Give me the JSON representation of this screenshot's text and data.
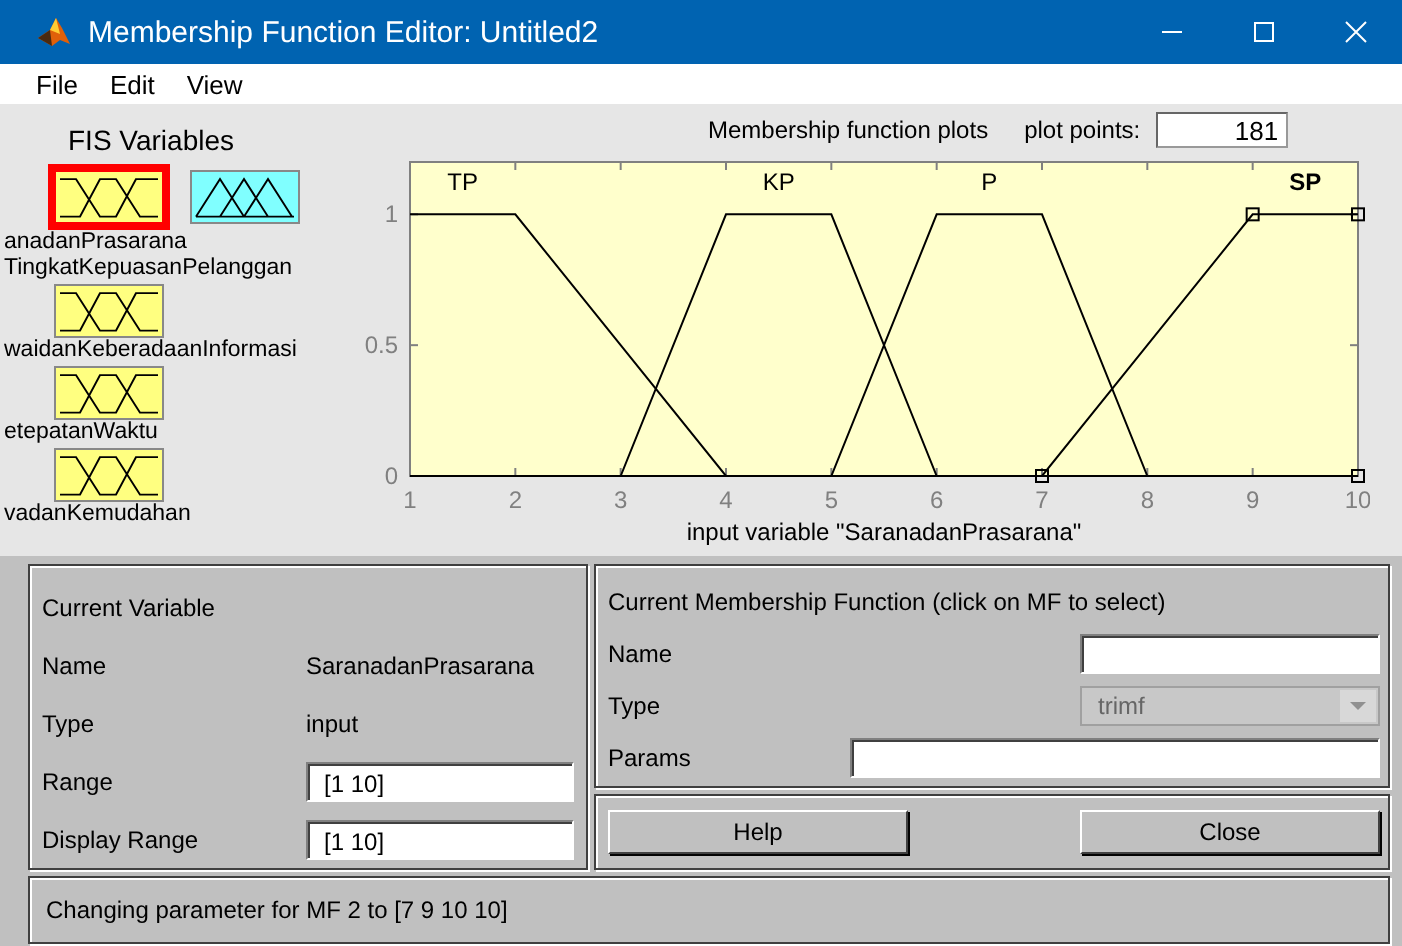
{
  "window": {
    "title": "Membership Function Editor: Untitled2"
  },
  "menu": [
    "File",
    "Edit",
    "View"
  ],
  "fis_variables": {
    "title": "FIS Variables",
    "variables": [
      {
        "kind": "input",
        "label": "anadanPrasarana",
        "selected": true
      },
      {
        "kind": "output",
        "label": "TingkatKepuasanPelanggan",
        "selected": false
      },
      {
        "kind": "input",
        "label": "waidanKeberadaanInformasi",
        "selected": false
      },
      {
        "kind": "input",
        "label": "etepatanWaktu",
        "selected": false
      },
      {
        "kind": "input",
        "label": "vadanKemudahan",
        "selected": false
      }
    ]
  },
  "plot": {
    "title": "Membership function plots",
    "plot_points_label": "plot points:",
    "plot_points": "181",
    "chart_data": {
      "type": "line",
      "xlabel": "input variable \"SaranadanPrasarana\"",
      "x": [
        1,
        2,
        3,
        4,
        5,
        6,
        7,
        8,
        9,
        10
      ],
      "xlim": [
        1,
        10
      ],
      "ylim": [
        0,
        1.2
      ],
      "xticks": [
        1,
        2,
        3,
        4,
        5,
        6,
        7,
        8,
        9,
        10
      ],
      "yticks": [
        0,
        0.5,
        1
      ],
      "series": [
        {
          "name": "TP",
          "color": "#000000",
          "values": [
            1,
            1,
            0.5,
            0,
            0,
            0,
            0,
            0,
            0,
            0
          ]
        },
        {
          "name": "KP",
          "color": "#000000",
          "values": [
            0,
            0,
            0,
            1,
            1,
            0,
            0,
            0,
            0,
            0
          ]
        },
        {
          "name": "P",
          "color": "#000000",
          "values": [
            0,
            0,
            0,
            0,
            0,
            1,
            1,
            0,
            0,
            0
          ]
        },
        {
          "name": "SP",
          "color": "#000000",
          "values": [
            0,
            0,
            0,
            0,
            0,
            0,
            0,
            0.5,
            1,
            1
          ]
        }
      ]
    },
    "mfs": [
      {
        "selected": false
      },
      {
        "selected": false
      },
      {
        "selected": false
      },
      {
        "selected": true
      }
    ]
  },
  "current_variable": {
    "title": "Current Variable",
    "name_label": "Name",
    "name": "SaranadanPrasarana",
    "type_label": "Type",
    "type": "input",
    "range_label": "Range",
    "range": "[1 10]",
    "display_range_label": "Display Range",
    "display_range": "[1 10]"
  },
  "current_mf": {
    "title": "Current Membership Function (click on MF to select)",
    "name_label": "Name",
    "type_label": "Type",
    "type": "trimf",
    "type_disabled": true,
    "params_label": "Params"
  },
  "buttons": [
    "Help",
    "Close"
  ],
  "status": "Changing parameter for MF 2 to  [7 9 10 10]"
}
